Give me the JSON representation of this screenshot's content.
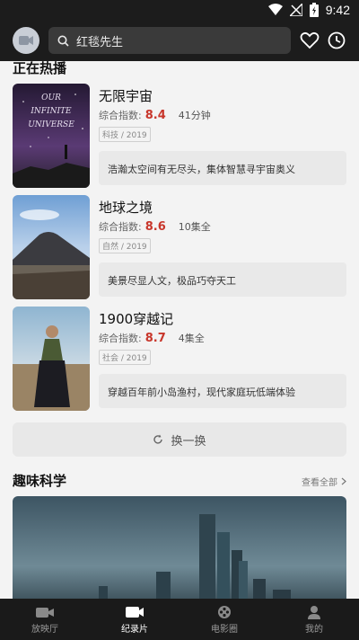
{
  "status_bar": {
    "time": "9:42"
  },
  "header": {
    "search_text": "红毯先生",
    "icons": [
      "avatar-icon",
      "search-icon",
      "heart-icon",
      "clock-icon"
    ]
  },
  "sections": {
    "hot": {
      "title": "正在热播"
    },
    "science": {
      "title": "趣味科学",
      "see_all": "查看全部"
    }
  },
  "items": [
    {
      "title": "无限宇宙",
      "score_label": "综合指数:",
      "score": "8.4",
      "extra": "41分钟",
      "tag": "科技 / 2019",
      "desc": "浩瀚太空间有无尽头，集体智慧寻宇宙奥义",
      "poster_text": "OUR INFINITE UNIVERSE"
    },
    {
      "title": "地球之境",
      "score_label": "综合指数:",
      "score": "8.6",
      "extra": "10集全",
      "tag": "自然 / 2019",
      "desc": "美景尽显人文，极品巧夺天工"
    },
    {
      "title": "1900穿越记",
      "score_label": "综合指数:",
      "score": "8.7",
      "extra": "4集全",
      "tag": "社会 / 2019",
      "desc": "穿越百年前小岛渔村，现代家庭玩低端体验"
    }
  ],
  "refresh_label": "换一换",
  "bottom_nav": [
    {
      "label": "放映厅",
      "icon": "camera-icon",
      "active": false
    },
    {
      "label": "纪录片",
      "icon": "video-icon",
      "active": true
    },
    {
      "label": "电影圈",
      "icon": "film-reel-icon",
      "active": false
    },
    {
      "label": "我的",
      "icon": "profile-icon",
      "active": false
    }
  ],
  "colors": {
    "score": "#c8362b",
    "topbar": "#1c1c1c",
    "bottombar": "#1a1a1a"
  }
}
